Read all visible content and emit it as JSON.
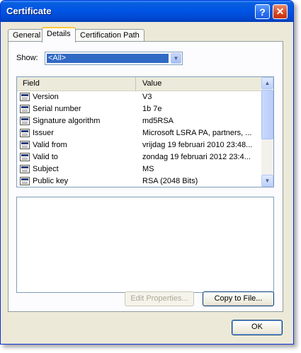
{
  "window": {
    "title": "Certificate"
  },
  "titlebar_buttons": {
    "help_icon": "?",
    "close_icon": "✕"
  },
  "tabs": [
    {
      "label": "General"
    },
    {
      "label": "Details"
    },
    {
      "label": "Certification Path"
    }
  ],
  "details": {
    "show_label": "Show:",
    "show_value": "<All>",
    "columns": {
      "field": "Field",
      "value": "Value"
    },
    "rows": [
      {
        "field": "Version",
        "value": "V3"
      },
      {
        "field": "Serial number",
        "value": "1b 7e"
      },
      {
        "field": "Signature algorithm",
        "value": "md5RSA"
      },
      {
        "field": "Issuer",
        "value": "Microsoft LSRA PA, partners, ..."
      },
      {
        "field": "Valid from",
        "value": "vrijdag 19 februari 2010 23:48..."
      },
      {
        "field": "Valid to",
        "value": "zondag 19 februari 2012 23:4..."
      },
      {
        "field": "Subject",
        "value": "MS"
      },
      {
        "field": "Public key",
        "value": "RSA (2048 Bits)"
      }
    ],
    "edit_properties_label": "Edit Properties...",
    "copy_to_file_label": "Copy to File..."
  },
  "ok_label": "OK",
  "colors": {
    "title_bar": "#0055e5",
    "selection": "#316ac5",
    "dialog_bg": "#ece9d8"
  }
}
